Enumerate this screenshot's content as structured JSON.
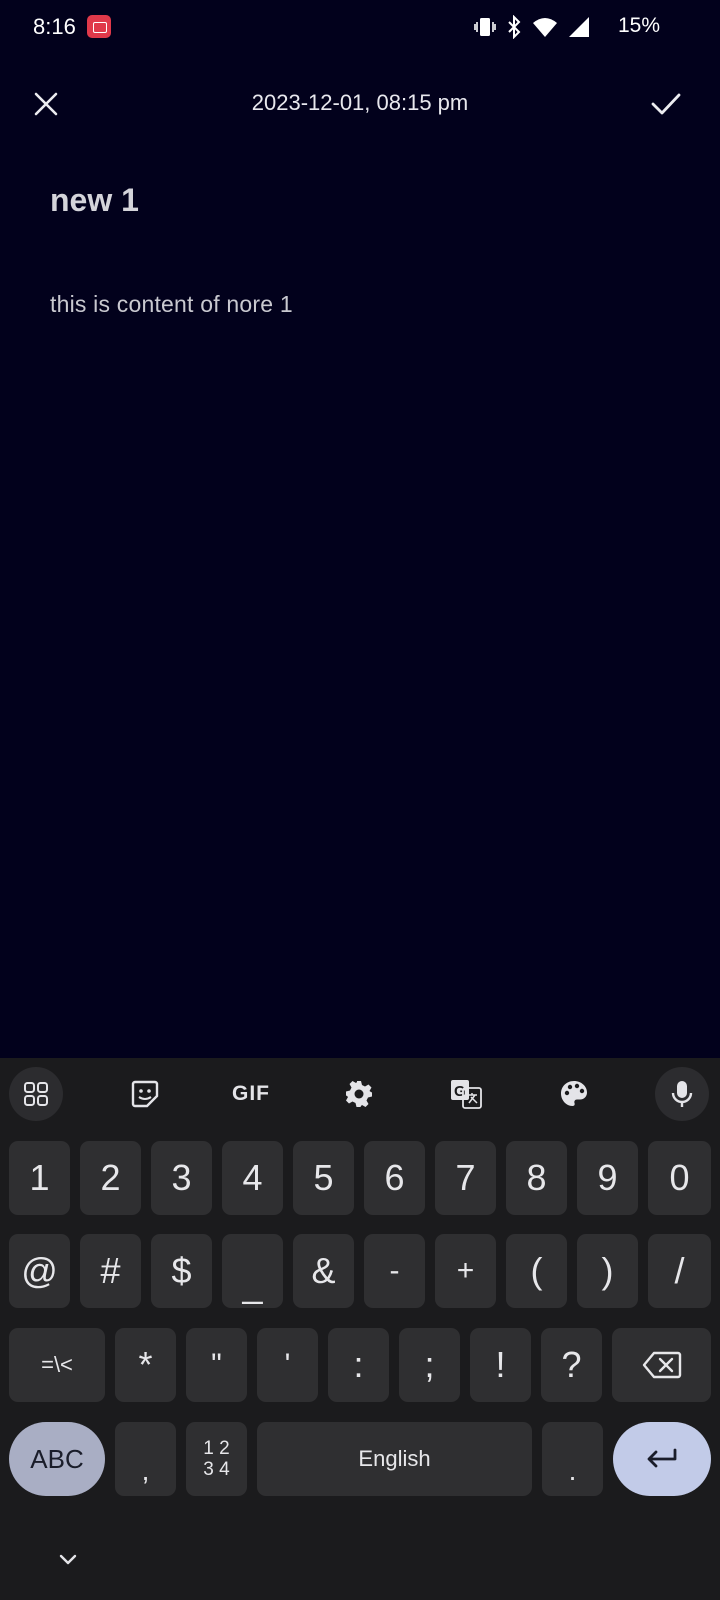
{
  "status_bar": {
    "time": "8:16",
    "battery": "15%",
    "icons": [
      "screen-record-icon",
      "vibrate-icon",
      "bluetooth-icon",
      "wifi-icon",
      "signal-icon"
    ]
  },
  "toolbar": {
    "date": "2023-12-01, 08:15 pm",
    "close_icon": "close-icon",
    "save_icon": "check-icon"
  },
  "note": {
    "title": "new 1",
    "body": "this is content of nore 1"
  },
  "keyboard": {
    "toolbar": {
      "apps_icon": "grid-icon",
      "sticker_icon": "sticker-icon",
      "gif_label": "GIF",
      "settings_icon": "gear-icon",
      "translate_icon": "translate-icon",
      "theme_icon": "palette-icon",
      "mic_icon": "mic-icon"
    },
    "row1": [
      "1",
      "2",
      "3",
      "4",
      "5",
      "6",
      "7",
      "8",
      "9",
      "0"
    ],
    "row2": [
      "@",
      "#",
      "$",
      "_",
      "&",
      "-",
      "+",
      "(",
      ")",
      "/"
    ],
    "row3": {
      "more_symbols": "=\\<",
      "keys": [
        "*",
        "\"",
        "'",
        ":",
        ";",
        "!",
        "?"
      ]
    },
    "row4": {
      "abc": "ABC",
      "comma": ",",
      "numpad_top": "1 2",
      "numpad_bottom": "3 4",
      "space": "English",
      "period": "."
    },
    "accent_color": "#c2cbe8"
  }
}
